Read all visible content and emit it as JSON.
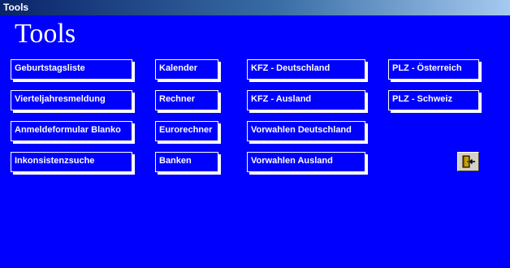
{
  "window": {
    "title": "Tools"
  },
  "heading": "Tools",
  "tools": {
    "col1": [
      "Geburtstagsliste",
      "Vierteljahresmeldung",
      "Anmeldeformular Blanko",
      "Inkonsistenzsuche"
    ],
    "col2": [
      "Kalender",
      "Rechner",
      "Eurorechner",
      "Banken"
    ],
    "col3": [
      "KFZ - Deutschland",
      "KFZ - Ausland",
      "Vorwahlen Deutschland",
      "Vorwahlen Ausland"
    ],
    "col4": [
      "PLZ - Österreich",
      "PLZ - Schweiz"
    ]
  },
  "exit_button": {
    "icon": "exit-door-icon"
  },
  "colors": {
    "background": "#0000FF",
    "text": "#FFFFFF"
  }
}
